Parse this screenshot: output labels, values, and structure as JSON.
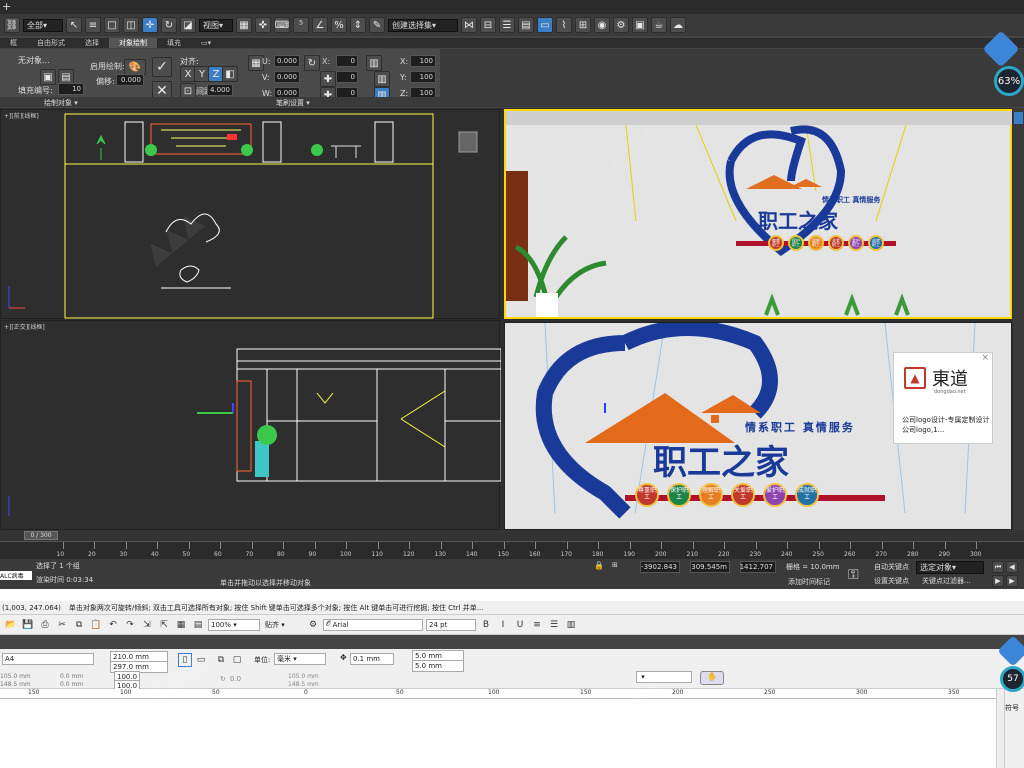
{
  "top_toolbar": {
    "select_filter": "全部",
    "view_select": "视图",
    "selection_set": "创建选择集"
  },
  "ribbon_tabs": [
    "框",
    "自由形式",
    "选择",
    "对象绘制",
    "填充"
  ],
  "ribbon": {
    "obj_label": "无对象...",
    "fill_index_label": "填充编号:",
    "fill_index_value": "10",
    "paint_label": "启用绘制:",
    "offset_label": "偏移:",
    "offset_value": "0.000",
    "align_label": "对齐:",
    "spacing_label": "间距:",
    "spacing_value": "4.000",
    "u_label": "U:",
    "u_value": "0.000",
    "v_label": "V:",
    "v_value": "0.000",
    "w_label": "W:",
    "w_value": "0.000",
    "n1": "0",
    "n2": "0",
    "n3": "0",
    "x_label": "X:",
    "x_value": "100",
    "y_label": "Y:",
    "y_value": "100",
    "z_label": "Z:",
    "z_value": "100",
    "group_draw": "绘制对象 ▾",
    "group_brush": "笔刷设置 ▾"
  },
  "viewports": {
    "top_left_label": "+][前][线框]",
    "bottom_left_label": "+][正交][线框]"
  },
  "render": {
    "slogan": "情系职工 真情服务",
    "title": "职工之家",
    "badges": [
      "尊重职工",
      "保护职工",
      "理解职工",
      "关爱职工",
      "爱护职工",
      "成就职工"
    ],
    "badge_colors": [
      "#c0392b",
      "#1e8449",
      "#e67e22",
      "#c0392b",
      "#8e44ad",
      "#2471a3"
    ]
  },
  "ad": {
    "brand": "東道",
    "domain": "dongdao.net",
    "text": "公司logo设计-专属定制设计公司logo,1..."
  },
  "progress_badges": {
    "top": "63%",
    "bottom": "57"
  },
  "timeline": {
    "frame": "0 / 300",
    "ticks": [
      "10",
      "20",
      "30",
      "40",
      "50",
      "60",
      "70",
      "80",
      "90",
      "100",
      "110",
      "120",
      "130",
      "140",
      "150",
      "160",
      "170",
      "180",
      "190",
      "200",
      "210",
      "220",
      "230",
      "240",
      "250",
      "260",
      "270",
      "280",
      "290",
      "300"
    ]
  },
  "status": {
    "selected": "选择了 1 个组",
    "hint": "单击并拖动以选择并移动对象",
    "render_time": "渲染时间 0:03:34",
    "x_val": "-3902.843",
    "y_val": "309.545m",
    "z_val": "1412.707",
    "grid": "栅格 = 10.0mm",
    "add_tag": "添加时间标记",
    "auto_key": "自动关键点",
    "set_key": "设置关键点",
    "key_filter": "关键点过滤器...",
    "selected_obj": "选定对象",
    "script_label": "ALC病毒",
    "coords": "(1,003, 247.064)"
  },
  "cdr": {
    "hint": "单击对象两次可旋转/倾斜; 双击工具可选择所有对象; 按住 Shift 键单击可选择多个对象; 按住 Alt 键单击可进行挖掘; 按住 Ctrl 并单...",
    "zoom": "100%",
    "snap": "贴齐",
    "font": "Arial",
    "font_size": "24 pt",
    "page_size": "A4",
    "width": "210.0 mm",
    "height": "297.0 mm",
    "units_label": "单位:",
    "units": "毫米",
    "nudge": "0.1 mm",
    "dup_x": "5.0 mm",
    "dup_y": "5.0 mm",
    "pos_x": "105.0 mm",
    "pos_y": "148.5 mm",
    "size_a": "0.0 mm",
    "size_b": "0.0 mm",
    "scale_x": "100.0",
    "scale_y": "100.0",
    "angle": "0.0",
    "pos_x2": "105.0 mm",
    "pos_y2": "148.5 mm",
    "side_label": "符号",
    "ruler": [
      "150",
      "100",
      "50",
      "0",
      "50",
      "100",
      "150",
      "200",
      "250",
      "300",
      "350"
    ]
  }
}
